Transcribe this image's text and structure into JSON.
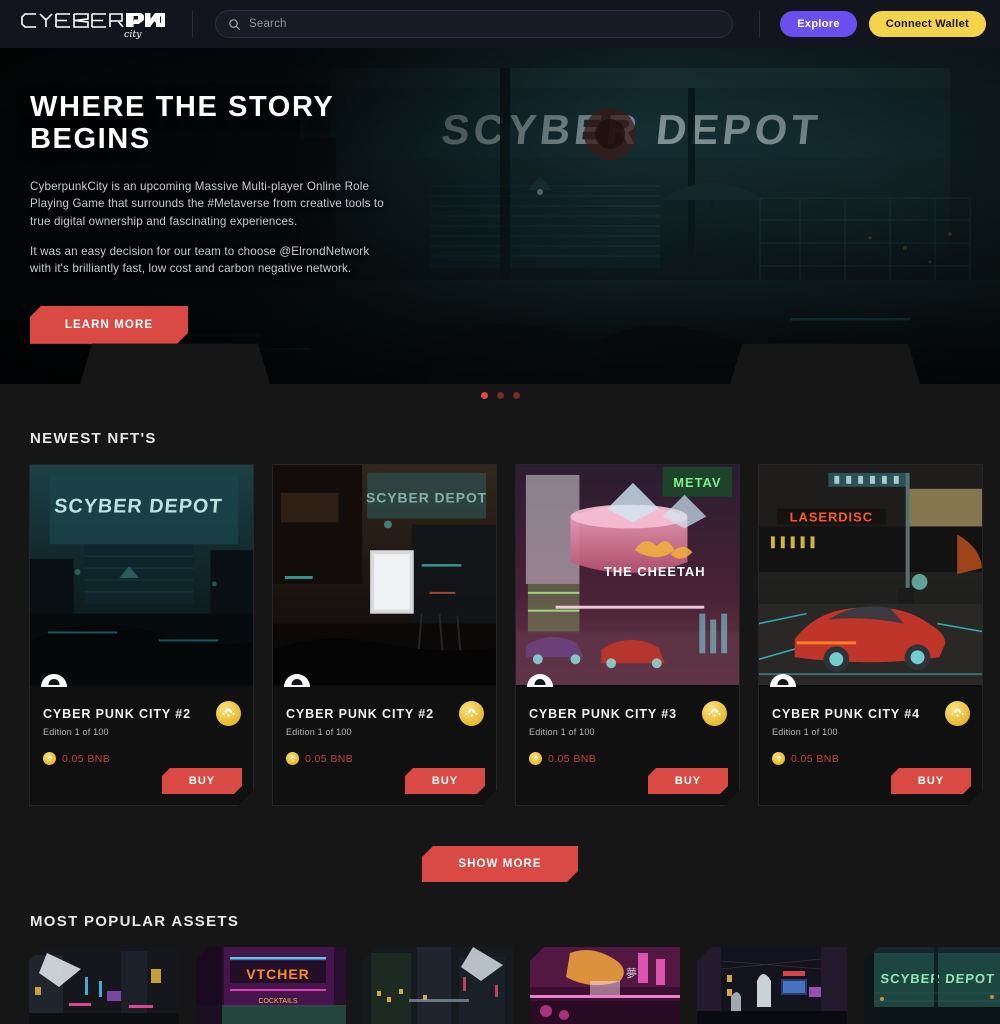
{
  "header": {
    "logo_text": "CYBERPUNK",
    "logo_sub": "city",
    "search": {
      "placeholder": "Search",
      "value": ""
    },
    "search_icon": "search-icon",
    "explore_label": "Explore",
    "wallet_label": "Connect Wallet",
    "colors": {
      "explore": "#6b4ef0",
      "wallet": "#f5d34b",
      "bar": "#12151d"
    }
  },
  "hero": {
    "title": "WHERE THE STORY BEGINS",
    "paragraph_1": "CyberpunkCity is an upcoming Massive Multi-player Online Role Playing Game that surrounds the #Metaverse from creative tools to true digital ownership and fascinating experiences.",
    "paragraph_2": "It was an easy decision for our team to choose @ElrondNetwork with it's brilliantly fast, low cost and carbon negative network.",
    "cta_label": "LEARN MORE",
    "cta_color": "#d94a44",
    "signage_text": "SCYBER DEPOT",
    "carousel": {
      "total": 3,
      "active_index": 0
    }
  },
  "sections": {
    "newest_title": "NEWEST NFT'S",
    "popular_title": "MOST POPULAR ASSETS",
    "show_more_label": "SHOW MORE"
  },
  "cards": [
    {
      "title": "CYBER PUNK CITY #2",
      "edition": "Edition 1 of 100",
      "price": "0.05 BNB",
      "buy_label": "BUY",
      "badge": "bnb-icon",
      "avatar": "avatar-icon"
    },
    {
      "title": "CYBER PUNK CITY #2",
      "edition": "Edition 1 of 100",
      "price": "0.05 BNB",
      "buy_label": "BUY",
      "badge": "bnb-icon",
      "avatar": "avatar-icon"
    },
    {
      "title": "CYBER PUNK CITY #3",
      "edition": "Edition 1 of 100",
      "price": "0.05 BNB",
      "buy_label": "BUY",
      "badge": "bnb-icon",
      "avatar": "avatar-icon"
    },
    {
      "title": "CYBER PUNK CITY #4",
      "edition": "Edition 1 of 100",
      "price": "0.05 BNB",
      "buy_label": "BUY",
      "badge": "bnb-icon",
      "avatar": "avatar-icon"
    }
  ],
  "card_scene_signage": [
    "SCYBER DEPOT",
    "METAVERSE",
    "THE CHEETAH",
    "LASERDISC"
  ],
  "popular_thumbs": [
    {
      "signage": ""
    },
    {
      "signage": "VTCHER"
    },
    {
      "signage": ""
    },
    {
      "signage": ""
    },
    {
      "signage": ""
    },
    {
      "signage": "SCYBER DEPOT"
    }
  ],
  "colors": {
    "page_bg": "#161616",
    "card_bg": "#101010",
    "accent_red": "#d94a44",
    "price_red": "#c0403a",
    "gold": "#e0a914"
  }
}
